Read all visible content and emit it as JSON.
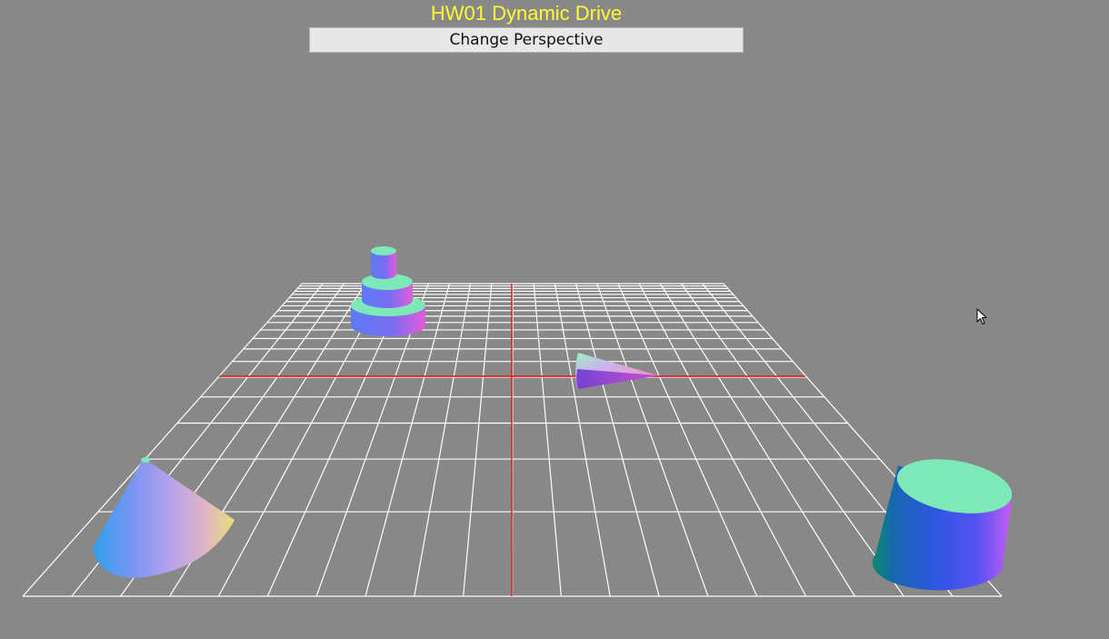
{
  "window": {
    "title": "HW01 Dynamic Drive"
  },
  "controls": {
    "change_perspective_label": "Change Perspective"
  },
  "scene": {
    "background_color": "#888888",
    "grid_color": "#ffffff",
    "axis_color": "#dd1111",
    "title_color": "#ffff33",
    "objects": [
      {
        "name": "tiered-cylinders",
        "kind": "stacked cylinders",
        "tiers": 3
      },
      {
        "name": "small-cone",
        "kind": "cone"
      },
      {
        "name": "large-cone",
        "kind": "cone"
      },
      {
        "name": "cylinder",
        "kind": "cylinder"
      }
    ],
    "cursor_icon": "arrow-pointer-icon"
  }
}
